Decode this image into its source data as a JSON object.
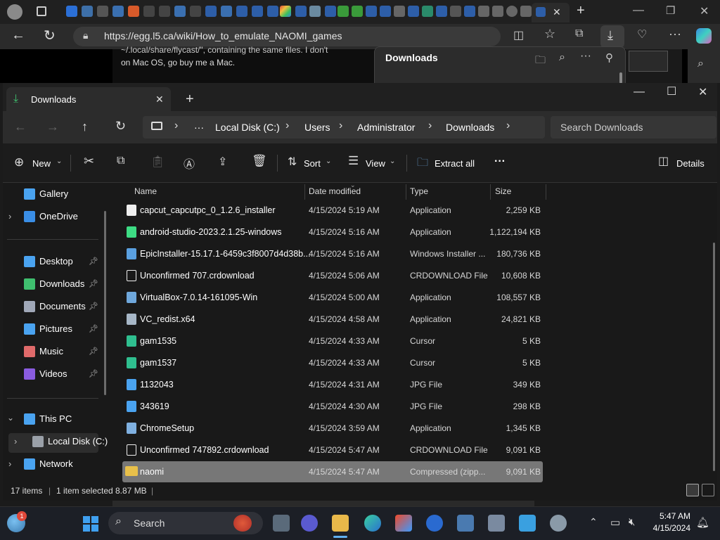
{
  "browser": {
    "url": "https://egg.l5.ca/wiki/How_to_emulate_NAOMI_games",
    "page_line1": "~/.local/share/flycast/\", containing the same files. I don't",
    "page_line2": "on Mac OS, go buy me a Mac.",
    "downloads_panel_title": "Downloads",
    "tab_add": "+",
    "close_tab": "✕"
  },
  "explorer": {
    "tab_title": "Downloads",
    "tab_close": "✕",
    "new_tab": "+",
    "window_controls": {
      "minimize": "—",
      "maximize": "☐",
      "close": "✕"
    },
    "breadcrumb": [
      "Local Disk (C:)",
      "Users",
      "Administrator",
      "Downloads"
    ],
    "breadcrumb_more": "···",
    "search_placeholder": "Search Downloads",
    "commands": {
      "new": "New",
      "sort": "Sort",
      "view": "View",
      "extract_all": "Extract all",
      "more": "···",
      "details": "Details"
    },
    "columns": {
      "name": "Name",
      "date": "Date modified",
      "type": "Type",
      "size": "Size"
    },
    "sidebar": [
      {
        "label": "Gallery",
        "icon": "gallery-icon",
        "color": "#4aa3f0",
        "pinned": false
      },
      {
        "label": "OneDrive",
        "icon": "cloud-icon",
        "color": "#3a8ee6",
        "pinned": false,
        "expandable": true
      },
      {
        "label": "Desktop",
        "icon": "desktop-icon",
        "color": "#4aa3f0",
        "pinned": true
      },
      {
        "label": "Downloads",
        "icon": "download-icon",
        "color": "#3fbf6f",
        "pinned": true
      },
      {
        "label": "Documents",
        "icon": "document-icon",
        "color": "#a0a8b8",
        "pinned": true
      },
      {
        "label": "Pictures",
        "icon": "picture-icon",
        "color": "#4aa3f0",
        "pinned": true
      },
      {
        "label": "Music",
        "icon": "music-icon",
        "color": "#e06a6a",
        "pinned": true
      },
      {
        "label": "Videos",
        "icon": "video-icon",
        "color": "#8a5ce0",
        "pinned": true
      },
      {
        "label": "This PC",
        "icon": "computer-icon",
        "color": "#4aa3f0",
        "pinned": false,
        "expanded": true
      },
      {
        "label": "Local Disk (C:)",
        "icon": "disk-icon",
        "color": "#9aa0a8",
        "pinned": false,
        "selected": true
      },
      {
        "label": "Network",
        "icon": "network-icon",
        "color": "#4aa3f0",
        "pinned": false,
        "expandable": true
      }
    ],
    "files": [
      {
        "name": "capcut_capcutpc_0_1.2.6_installer",
        "date": "4/15/2024 5:19 AM",
        "type": "Application",
        "size": "2,259 KB",
        "icon": "capcut-icon",
        "color": "#eeeeee"
      },
      {
        "name": "android-studio-2023.2.1.25-windows",
        "date": "4/15/2024 5:16 AM",
        "type": "Application",
        "size": "1,122,194 KB",
        "icon": "android-icon",
        "color": "#3ddc84"
      },
      {
        "name": "EpicInstaller-15.17.1-6459c3f8007d4d38b...",
        "date": "4/15/2024 5:16 AM",
        "type": "Windows Installer ...",
        "size": "180,736 KB",
        "icon": "installer-icon",
        "color": "#5aa0e0"
      },
      {
        "name": "Unconfirmed 707.crdownload",
        "date": "4/15/2024 5:06 AM",
        "type": "CRDOWNLOAD File",
        "size": "10,608 KB",
        "icon": "file-icon",
        "color": "#f2f2f2"
      },
      {
        "name": "VirtualBox-7.0.14-161095-Win",
        "date": "4/15/2024 5:00 AM",
        "type": "Application",
        "size": "108,557 KB",
        "icon": "virtualbox-icon",
        "color": "#6fa8dc"
      },
      {
        "name": "VC_redist.x64",
        "date": "4/15/2024 4:58 AM",
        "type": "Application",
        "size": "24,821 KB",
        "icon": "vcredist-icon",
        "color": "#a7b7c7"
      },
      {
        "name": "gam1535",
        "date": "4/15/2024 4:33 AM",
        "type": "Cursor",
        "size": "5 KB",
        "icon": "cursor-icon",
        "color": "#2fbf8f"
      },
      {
        "name": "gam1537",
        "date": "4/15/2024 4:33 AM",
        "type": "Cursor",
        "size": "5 KB",
        "icon": "cursor-icon",
        "color": "#2fbf8f"
      },
      {
        "name": "1132043",
        "date": "4/15/2024 4:31 AM",
        "type": "JPG File",
        "size": "349 KB",
        "icon": "image-file-icon",
        "color": "#4aa3f0"
      },
      {
        "name": "343619",
        "date": "4/15/2024 4:30 AM",
        "type": "JPG File",
        "size": "298 KB",
        "icon": "image-file-icon",
        "color": "#4aa3f0"
      },
      {
        "name": "ChromeSetup",
        "date": "4/15/2024 3:59 AM",
        "type": "Application",
        "size": "1,345 KB",
        "icon": "setup-icon",
        "color": "#7fb0e0"
      },
      {
        "name": "Unconfirmed 747892.crdownload",
        "date": "4/15/2024 5:47 AM",
        "type": "CRDOWNLOAD File",
        "size": "9,091 KB",
        "icon": "file-icon",
        "color": "#f2f2f2"
      },
      {
        "name": "naomi",
        "date": "4/15/2024 5:47 AM",
        "type": "Compressed (zipp...",
        "size": "9,091 KB",
        "icon": "zip-folder-icon",
        "color": "#e8c04a",
        "selected": true
      }
    ],
    "status": {
      "items": "17 items",
      "selected": "1 item selected",
      "size": "8.87 MB",
      "separator": "|"
    }
  },
  "taskbar": {
    "search_label": "Search",
    "time": "5:47 AM",
    "date": "4/15/2024",
    "weather_badge": "1"
  },
  "colors": {
    "accent": "#4aa3f0",
    "selection": "#777777",
    "window_bg": "#191919",
    "toolbar_bg": "#2c2c2c"
  }
}
